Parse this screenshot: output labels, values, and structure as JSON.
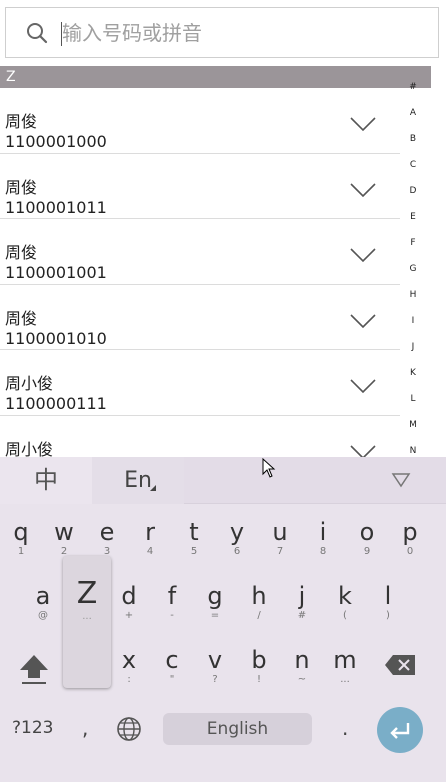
{
  "search": {
    "placeholder": "输入号码或拼音"
  },
  "section": {
    "letter": "Z"
  },
  "contacts": [
    {
      "name": "周俊",
      "number": "1100001000"
    },
    {
      "name": "周俊",
      "number": "1100001011"
    },
    {
      "name": "周俊",
      "number": "1100001001"
    },
    {
      "name": "周俊",
      "number": "1100001010"
    },
    {
      "name": "周小俊",
      "number": "1100000111"
    },
    {
      "name": "周小俊",
      "number": ""
    }
  ],
  "index_letters": [
    "#",
    "A",
    "B",
    "C",
    "D",
    "E",
    "F",
    "G",
    "H",
    "I",
    "J",
    "K",
    "L",
    "M",
    "N"
  ],
  "keyboard": {
    "zh_label": "中",
    "en_label": "En",
    "row1": [
      {
        "k": "q",
        "s": "1"
      },
      {
        "k": "w",
        "s": "2"
      },
      {
        "k": "e",
        "s": "3"
      },
      {
        "k": "r",
        "s": "4"
      },
      {
        "k": "t",
        "s": "5"
      },
      {
        "k": "y",
        "s": "6"
      },
      {
        "k": "u",
        "s": "7"
      },
      {
        "k": "i",
        "s": "8"
      },
      {
        "k": "o",
        "s": "9"
      },
      {
        "k": "p",
        "s": "0"
      }
    ],
    "row2": [
      {
        "k": "a",
        "s": "@"
      },
      {
        "k": "d",
        "s": "+"
      },
      {
        "k": "f",
        "s": "-"
      },
      {
        "k": "g",
        "s": "="
      },
      {
        "k": "h",
        "s": "/"
      },
      {
        "k": "j",
        "s": "#"
      },
      {
        "k": "k",
        "s": "("
      },
      {
        "k": "l",
        "s": ")"
      }
    ],
    "pressed": {
      "k": "Z",
      "s": "..."
    },
    "row3": [
      {
        "k": "x",
        "s": ":"
      },
      {
        "k": "c",
        "s": "\""
      },
      {
        "k": "v",
        "s": "?"
      },
      {
        "k": "b",
        "s": "!"
      },
      {
        "k": "n",
        "s": "~"
      },
      {
        "k": "m",
        "s": "..."
      }
    ],
    "symbols_label": "?123",
    "comma_label": ",",
    "space_label": "English",
    "period_label": "."
  }
}
